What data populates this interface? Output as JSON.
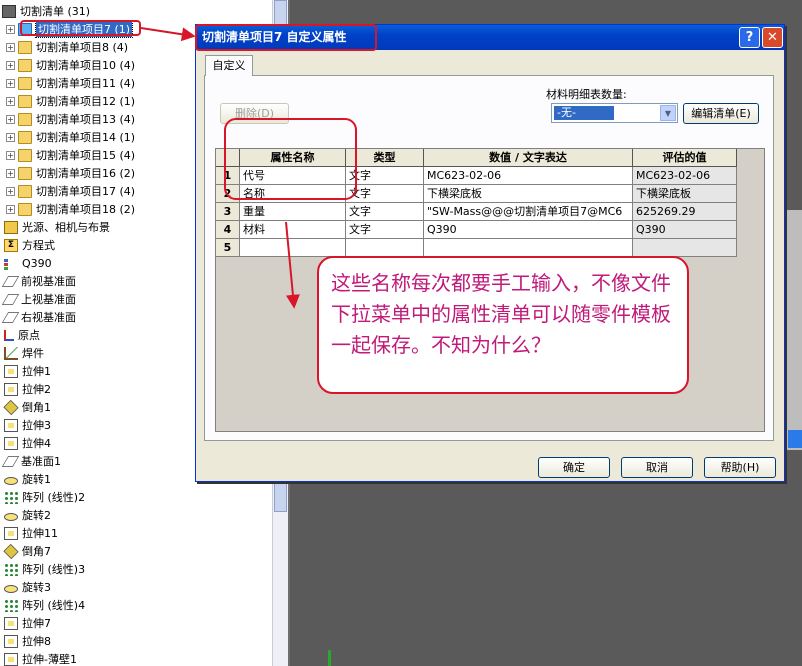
{
  "tree": {
    "root": "切割清单 (31)",
    "cutlists": [
      "切割清单项目7 (1)",
      "切割清单项目8 (4)",
      "切割清单项目10 (4)",
      "切割清单项目11 (4)",
      "切割清单项目12 (1)",
      "切割清单项目13 (4)",
      "切割清单项目14 (1)",
      "切割清单项目15 (4)",
      "切割清单项目16 (2)",
      "切割清单项目17 (4)",
      "切割清单项目18 (2)"
    ],
    "features": [
      {
        "label": "光源、相机与布景",
        "icon": "light-icon"
      },
      {
        "label": "方程式",
        "icon": "equation-icon"
      },
      {
        "label": "Q390",
        "icon": "material-icon"
      },
      {
        "label": "前视基准面",
        "icon": "plane-icon"
      },
      {
        "label": "上视基准面",
        "icon": "plane-icon"
      },
      {
        "label": "右视基准面",
        "icon": "plane-icon"
      },
      {
        "label": "原点",
        "icon": "origin-icon"
      },
      {
        "label": "焊件",
        "icon": "weldment-icon"
      },
      {
        "label": "拉伸1",
        "icon": "extrude-icon"
      },
      {
        "label": "拉伸2",
        "icon": "extrude-icon"
      },
      {
        "label": "倒角1",
        "icon": "chamfer-icon"
      },
      {
        "label": "拉伸3",
        "icon": "extrude-icon"
      },
      {
        "label": "拉伸4",
        "icon": "extrude-icon"
      },
      {
        "label": "基准面1",
        "icon": "plane-icon"
      },
      {
        "label": "旋转1",
        "icon": "revolve-icon"
      },
      {
        "label": "阵列 (线性)2",
        "icon": "pattern-icon"
      },
      {
        "label": "旋转2",
        "icon": "revolve-icon"
      },
      {
        "label": "拉伸11",
        "icon": "extrude-icon"
      },
      {
        "label": "倒角7",
        "icon": "chamfer-icon"
      },
      {
        "label": "阵列 (线性)3",
        "icon": "pattern-icon"
      },
      {
        "label": "旋转3",
        "icon": "revolve-icon"
      },
      {
        "label": "阵列 (线性)4",
        "icon": "pattern-icon"
      },
      {
        "label": "拉伸7",
        "icon": "extrude-icon"
      },
      {
        "label": "拉伸8",
        "icon": "extrude-icon"
      },
      {
        "label": "拉伸-薄壁1",
        "icon": "extrude-icon"
      }
    ]
  },
  "dialog": {
    "title": "切割清单项目7 自定义属性",
    "help": "?",
    "close": "✕",
    "tab": "自定义",
    "delete_btn": "删除(D)",
    "qty_label": "材料明细表数量:",
    "qty_value": "-无-",
    "edit_btn": "编辑清单(E)",
    "ok": "确定",
    "cancel": "取消",
    "helpbtn": "帮助(H)",
    "columns": [
      "属性名称",
      "类型",
      "数值 / 文字表达",
      "评估的值"
    ],
    "rows": [
      {
        "n": "1",
        "name": "代号",
        "type": "文字",
        "expr": "MC623-02-06",
        "eval": "MC623-02-06"
      },
      {
        "n": "2",
        "name": "名称",
        "type": "文字",
        "expr": "下横梁底板",
        "eval": "下横梁底板"
      },
      {
        "n": "3",
        "name": "重量",
        "type": "文字",
        "expr": "\"SW-Mass@@@切割清单项目7@MC6",
        "eval": "625269.29"
      },
      {
        "n": "4",
        "name": "材料",
        "type": "文字",
        "expr": "Q390",
        "eval": "Q390"
      },
      {
        "n": "5",
        "name": "",
        "type": "",
        "expr": "",
        "eval": ""
      }
    ]
  },
  "annotation": {
    "text": "这些名称每次都要手工输入，不像文件下拉菜单中的属性清单可以随零件模板一起保存。不知为什么？"
  }
}
